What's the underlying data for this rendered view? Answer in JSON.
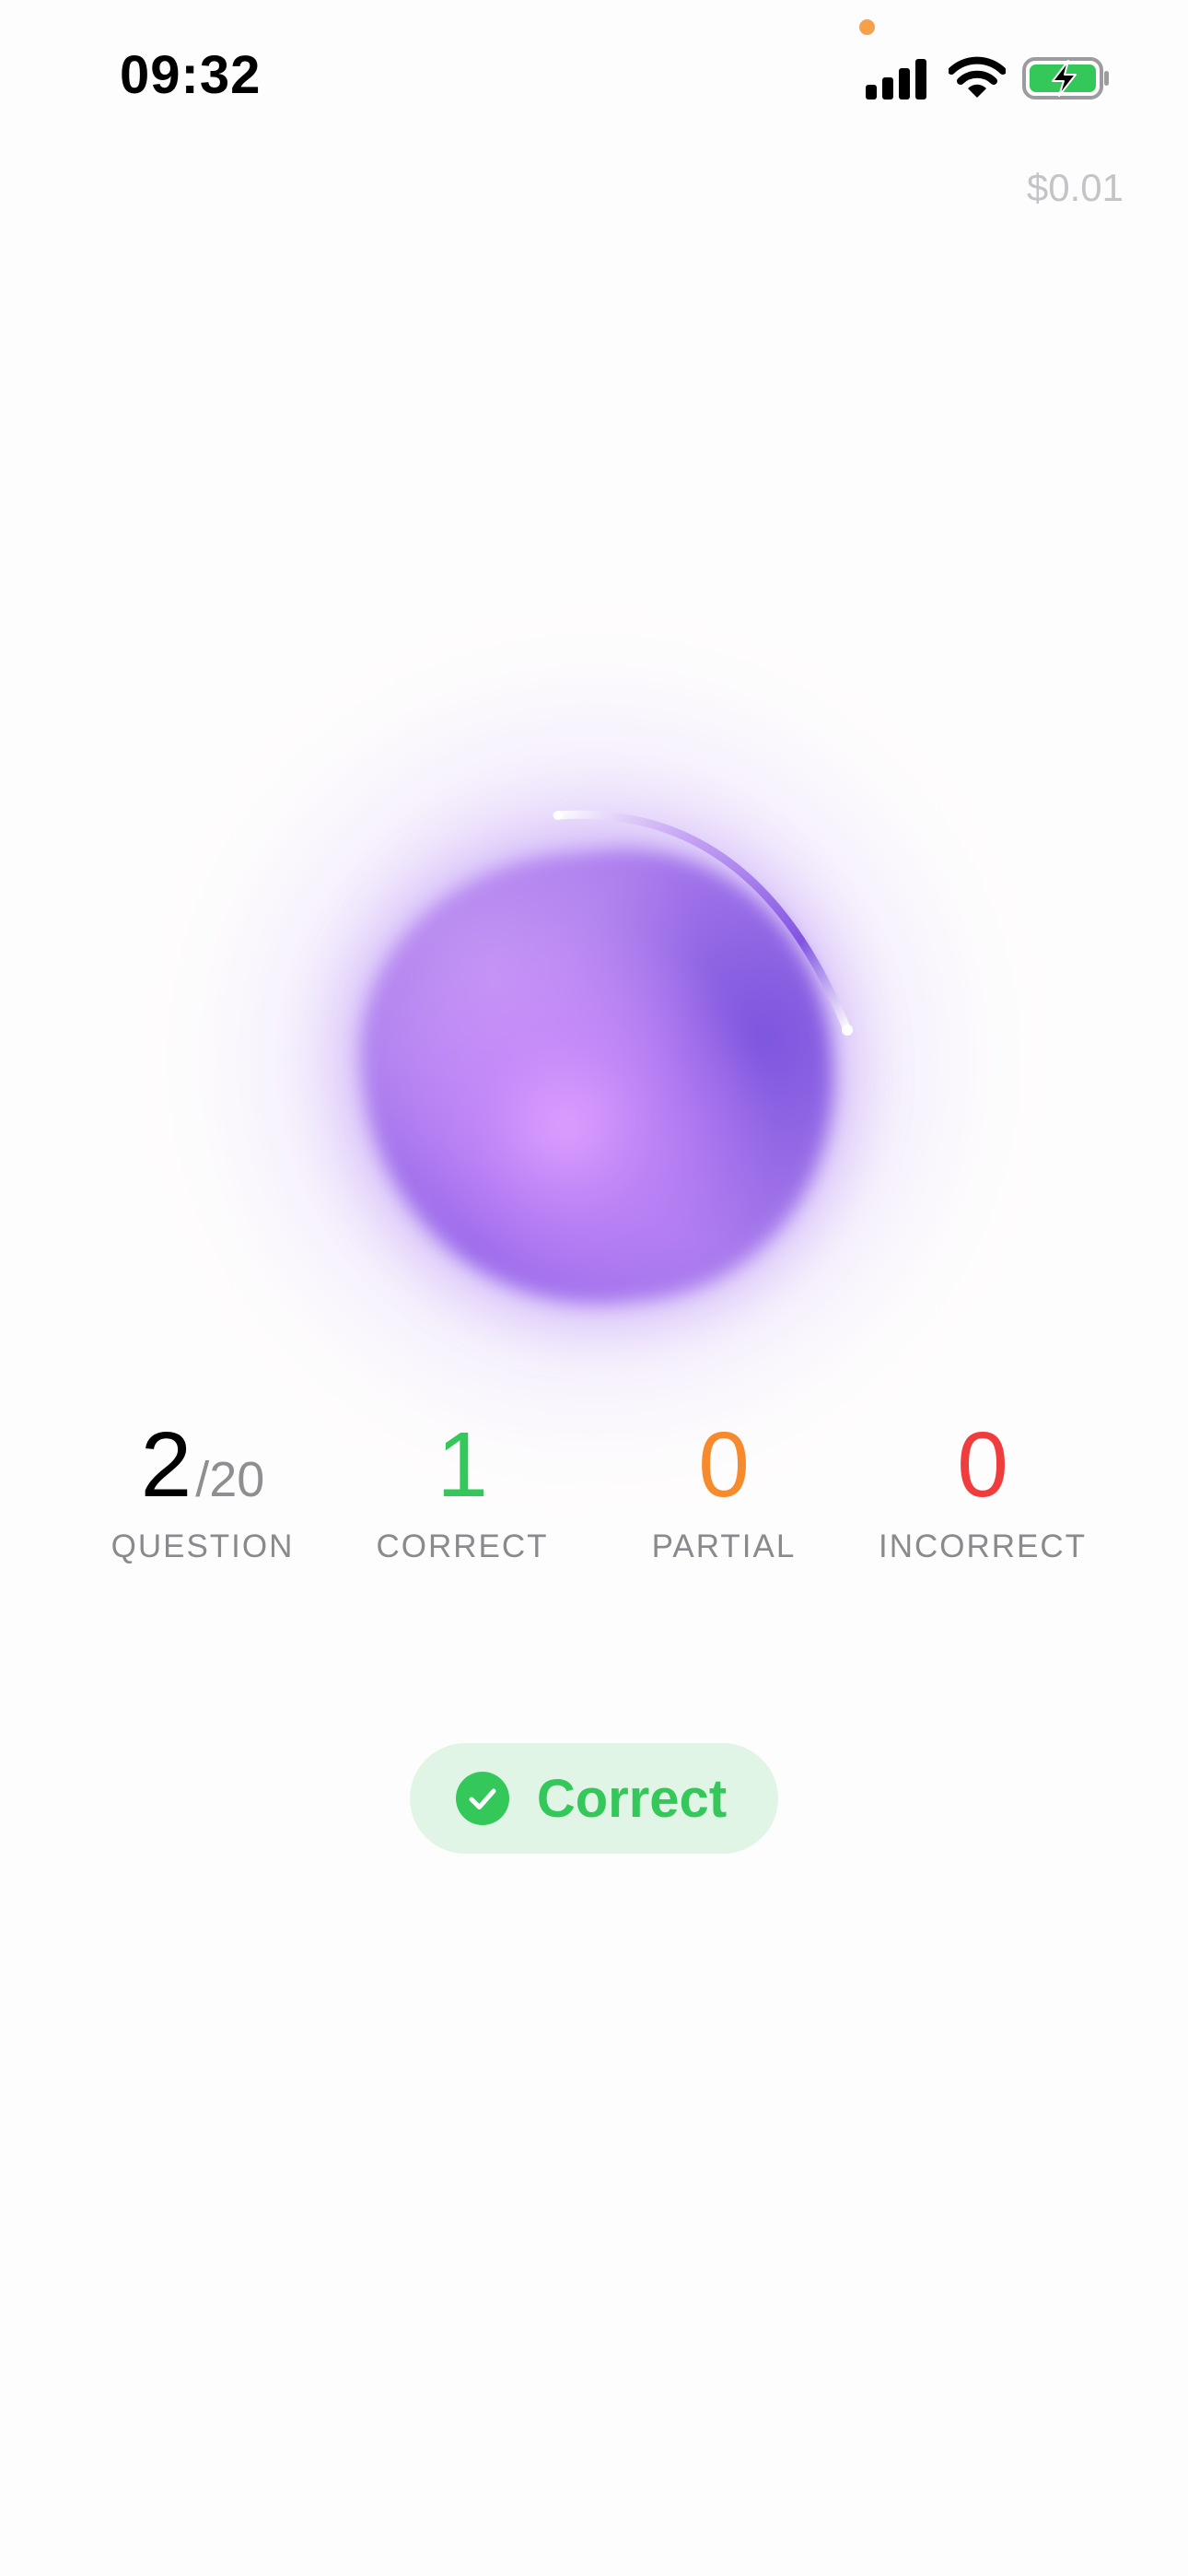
{
  "status_bar": {
    "time": "09:32",
    "privacy_indicator_color": "#f7a04a",
    "icons": [
      "signal-icon",
      "wifi-icon",
      "battery-charging-icon"
    ]
  },
  "cost": "$0.01",
  "orb": {
    "icon": "voice-orb",
    "color": "#a779ec"
  },
  "stats": {
    "question": {
      "value": "2",
      "total": "/20",
      "label": "QUESTION",
      "color": "#000000"
    },
    "correct": {
      "value": "1",
      "label": "CORRECT",
      "color": "#34c759"
    },
    "partial": {
      "value": "0",
      "label": "PARTIAL",
      "color": "#f68a2c"
    },
    "incorrect": {
      "value": "0",
      "label": "INCORRECT",
      "color": "#f03c3c"
    }
  },
  "result": {
    "label": "Correct",
    "icon": "checkmark-circle-icon",
    "color": "#34c759",
    "background": "#e1f5e6"
  }
}
